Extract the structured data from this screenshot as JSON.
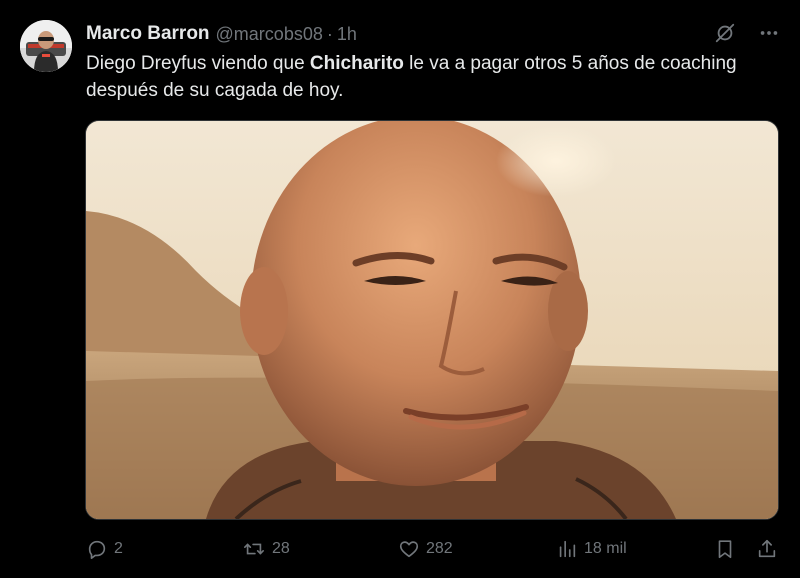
{
  "author": {
    "display_name": "Marco Barron",
    "handle": "@marcobs08",
    "separator": "·",
    "time": "1h"
  },
  "tweet": {
    "text_part1": "Diego Dreyfus viendo que ",
    "text_bold": "Chicharito",
    "text_part2": " le va a pagar otros 5 años de coaching después de su cagada de hoy."
  },
  "header_icons": [
    "grok-icon",
    "more-icon"
  ],
  "actions": {
    "replies": "2",
    "reposts": "28",
    "likes": "282",
    "views": "18 mil"
  },
  "colors": {
    "background": "#000000",
    "text_primary": "#e7e9ea",
    "text_secondary": "#71767b",
    "border": "#2f3336"
  }
}
